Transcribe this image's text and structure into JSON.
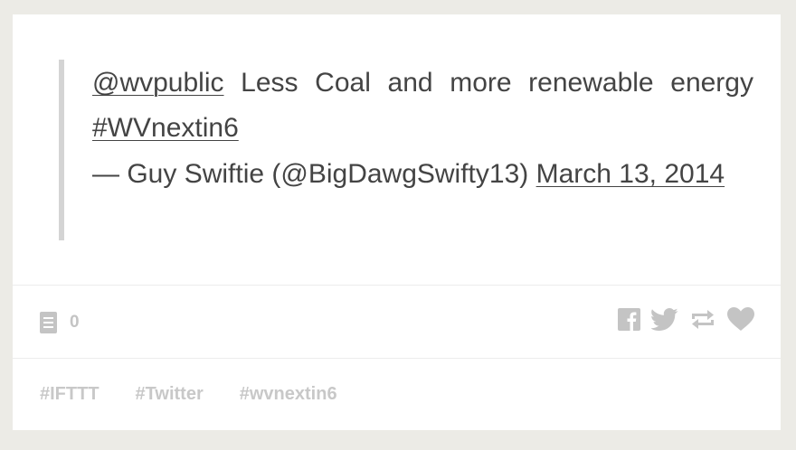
{
  "post": {
    "mention": "@wvpublic",
    "text": "Less Coal and more renewable energy",
    "hashtag": "#WVnextin6",
    "attribution": "— Guy Swiftie (@BigDawgSwifty13)",
    "date": "March 13, 2014"
  },
  "footer": {
    "notes_count": "0"
  },
  "tags": [
    "#IFTTT",
    "#Twitter",
    "#wvnextin6"
  ],
  "icons": {
    "notes": "notes-icon",
    "facebook": "facebook-icon",
    "twitter": "twitter-icon",
    "reblog": "reblog-icon",
    "like": "heart-icon"
  },
  "colors": {
    "background": "#ecebe6",
    "card": "#ffffff",
    "text": "#444444",
    "muted": "#c4c4c4",
    "quote_border": "#d4d4d4"
  }
}
